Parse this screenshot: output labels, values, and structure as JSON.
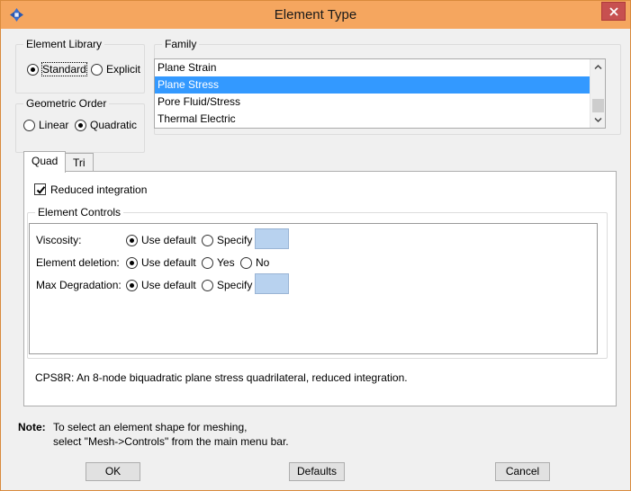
{
  "window": {
    "title": "Element Type"
  },
  "element_library": {
    "label": "Element Library",
    "options": [
      "Standard",
      "Explicit"
    ],
    "selected": "Standard"
  },
  "geometric_order": {
    "label": "Geometric Order",
    "options": [
      "Linear",
      "Quadratic"
    ],
    "selected": "Quadratic"
  },
  "family": {
    "label": "Family",
    "items": [
      "Plane Strain",
      "Plane Stress",
      "Pore Fluid/Stress",
      "Thermal Electric"
    ],
    "selected": "Plane Stress"
  },
  "tabs": [
    {
      "label": "Quad",
      "active": true
    },
    {
      "label": "Tri",
      "active": false
    }
  ],
  "reduced_integration": {
    "label": "Reduced integration",
    "checked": true
  },
  "element_controls": {
    "label": "Element Controls",
    "rows": [
      {
        "label": "Viscosity:",
        "options": [
          "Use default",
          "Specify"
        ],
        "selected": "Use default"
      },
      {
        "label": "Element deletion:",
        "options": [
          "Use default",
          "Yes",
          "No"
        ],
        "selected": "Use default"
      },
      {
        "label": "Max Degradation:",
        "options": [
          "Use default",
          "Specify"
        ],
        "selected": "Use default"
      }
    ]
  },
  "description": "CPS8R:  An 8-node biquadratic plane stress quadrilateral, reduced integration.",
  "note": {
    "label": "Note:",
    "line1": "To select an element shape for meshing,",
    "line2": "select \"Mesh->Controls\" from the main menu bar."
  },
  "buttons": {
    "ok": "OK",
    "defaults": "Defaults",
    "cancel": "Cancel"
  }
}
